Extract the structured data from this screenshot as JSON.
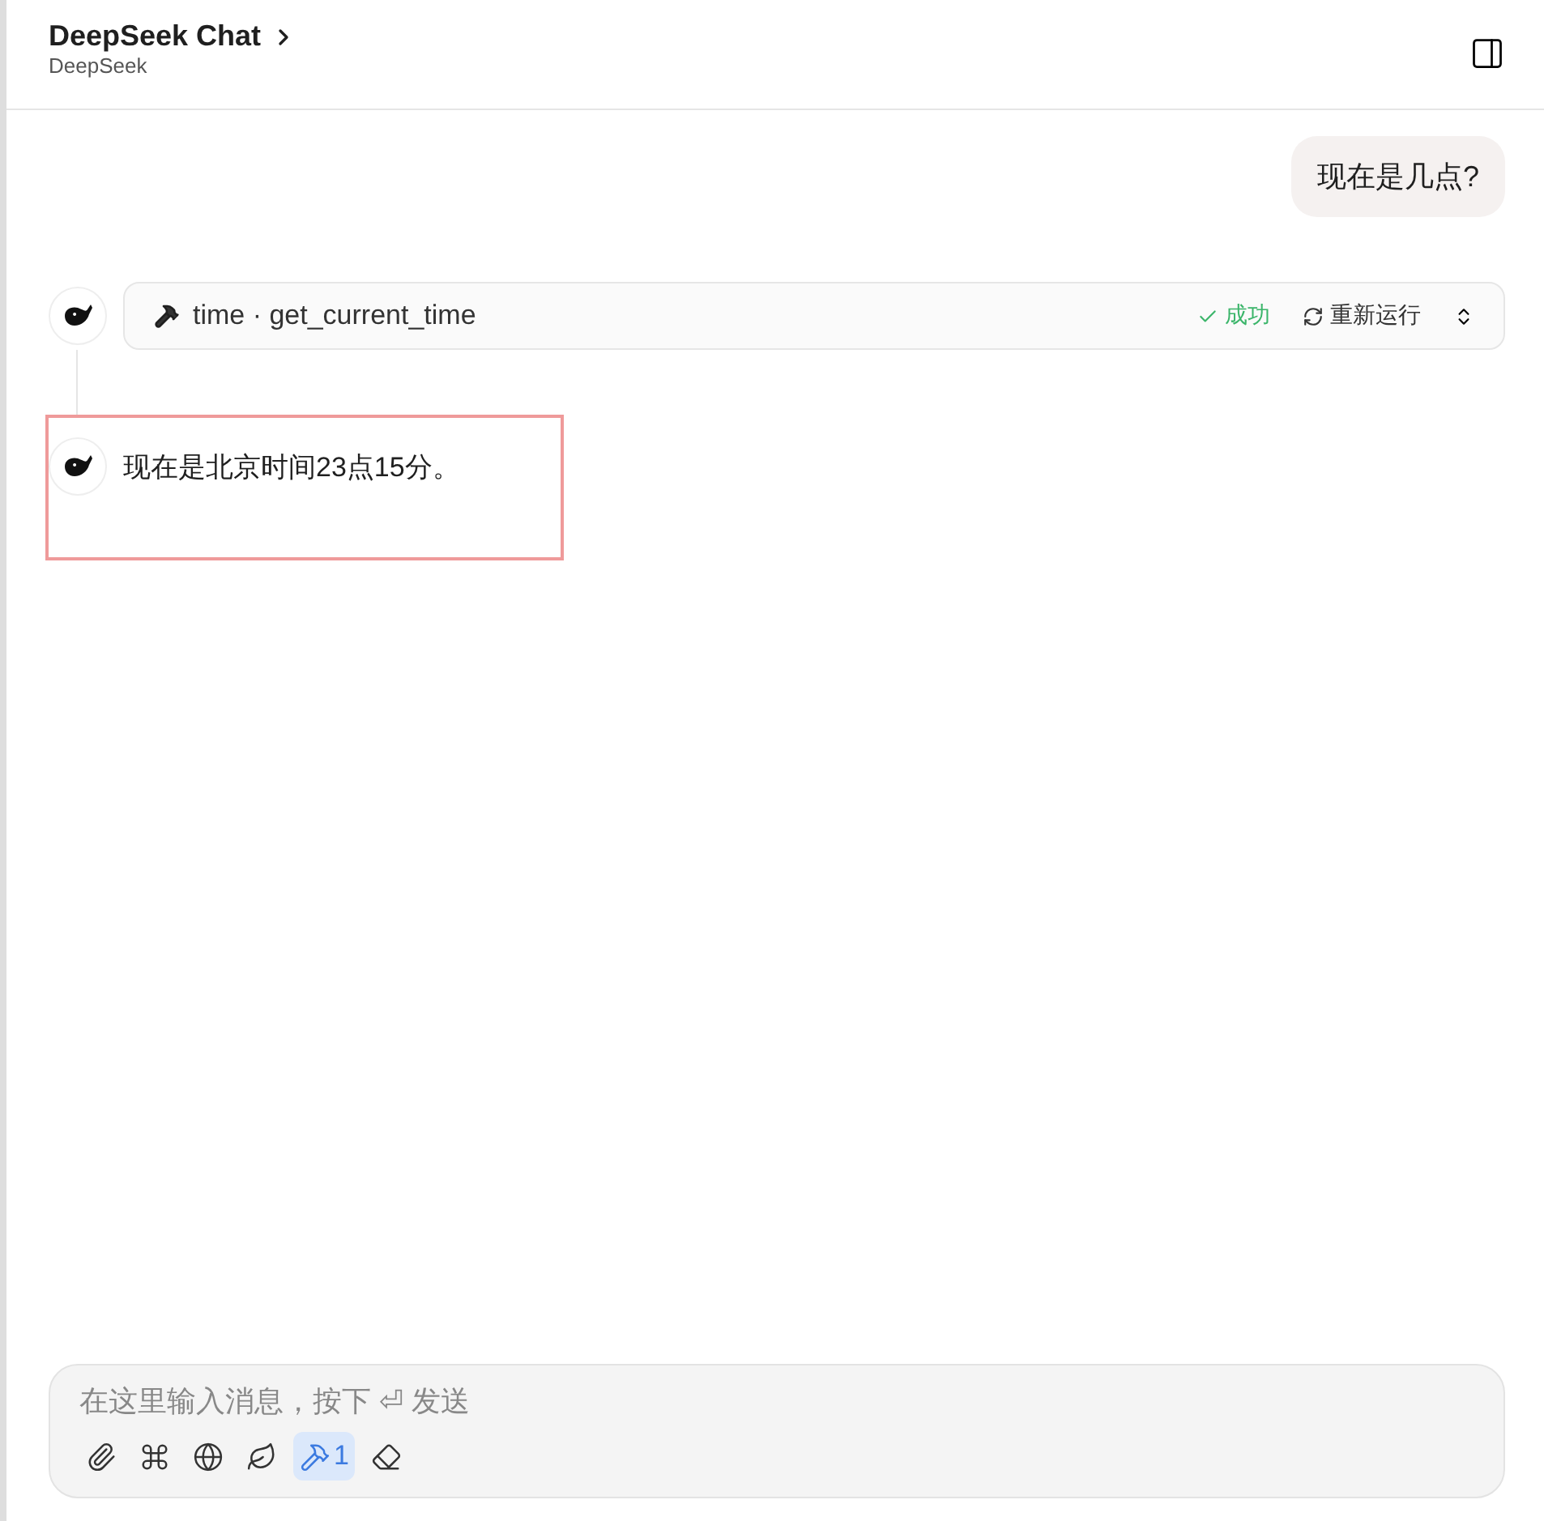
{
  "header": {
    "title": "DeepSeek Chat",
    "subtitle": "DeepSeek"
  },
  "messages": [
    {
      "kind": "user",
      "text": "现在是几点?"
    },
    {
      "kind": "tool",
      "name": "time · get_current_time",
      "status": "成功",
      "success": true,
      "rerun": "重新运行"
    },
    {
      "kind": "assistant",
      "text": "现在是北京时间23点15分。",
      "highlighted": true
    }
  ],
  "composer": {
    "placeholder": "在这里输入消息，按下 ⏎ 发送",
    "tools": [
      {
        "kind": "attach",
        "selected": false
      },
      {
        "kind": "command",
        "selected": false
      },
      {
        "kind": "web",
        "selected": false
      },
      {
        "kind": "leaf",
        "selected": false
      },
      {
        "kind": "tools",
        "selected": true,
        "count": "1"
      },
      {
        "kind": "clear",
        "selected": false
      }
    ]
  }
}
